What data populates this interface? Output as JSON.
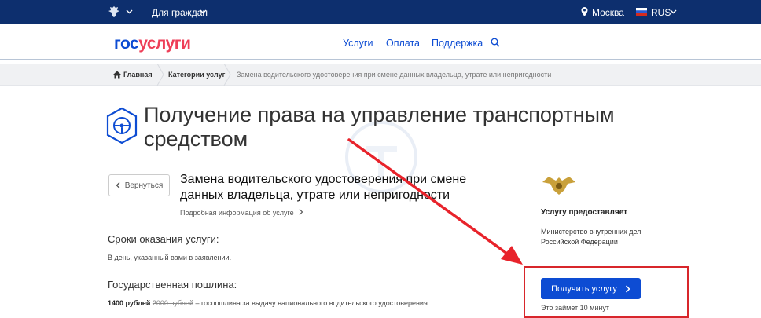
{
  "topbar": {
    "citizens_label": "Для граждан",
    "location": "Москва",
    "language": "RUS"
  },
  "header": {
    "logo_part1": "гос",
    "logo_part2": "услуги",
    "nav": [
      "Услуги",
      "Оплата",
      "Поддержка"
    ]
  },
  "breadcrumbs": [
    "Главная",
    "Категории услуг",
    "Замена водительского удостоверения при смене данных владельца, утрате или непригодности"
  ],
  "page": {
    "title": "Получение права на управление транспортным средством",
    "back_label": "Вернуться",
    "service_title": "Замена водительского удостоверения при смене данных владельца, утрате или непригодности",
    "more_info": "Подробная информация об услуге",
    "terms_heading": "Сроки оказания услуги:",
    "terms_text": "В день, указанный вами в заявлении.",
    "fee_heading": "Государственная пошлина:",
    "fee_price": "1400 рублей",
    "fee_old_price": "2000 рублей",
    "fee_text": "– госпошлина за выдачу национального водительского удостоверения."
  },
  "sidebar": {
    "provider_heading": "Услугу предоставляет",
    "provider_name": "Министерство внутренних дел Российской Федерации",
    "get_button": "Получить услугу",
    "duration": "Это займет 10 минут"
  },
  "colors": {
    "topbar": "#0d2f6e",
    "accent": "#0d4cd3",
    "logo_red": "#ee3f58",
    "annotation_red": "#d8262b"
  }
}
